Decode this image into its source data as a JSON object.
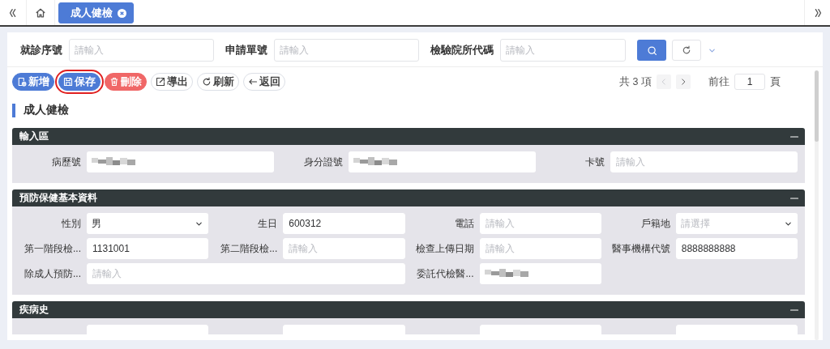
{
  "tabs": [
    {
      "label": "成人健檢",
      "selected": true,
      "closable": true
    }
  ],
  "search_fields": [
    {
      "label": "就診序號",
      "placeholder": "請輸入"
    },
    {
      "label": "申請單號",
      "placeholder": "請輸入"
    },
    {
      "label": "檢驗院所代碼",
      "placeholder": "請輸入"
    }
  ],
  "toolbar": [
    {
      "kind": "add",
      "label": "新增",
      "highlighted": false
    },
    {
      "kind": "save",
      "label": "保存",
      "highlighted": true
    },
    {
      "kind": "delete",
      "label": "刪除",
      "highlighted": false
    },
    {
      "kind": "export",
      "label": "導出",
      "highlighted": false
    },
    {
      "kind": "refresh",
      "label": "刷新",
      "highlighted": false
    },
    {
      "kind": "back",
      "label": "返回",
      "highlighted": false
    }
  ],
  "pager": {
    "total": "共 3 項",
    "prev_disabled": true,
    "next_disabled": false,
    "goto_label": "前往",
    "page": "1",
    "page_suffix": "頁"
  },
  "section_title": "成人健檢",
  "panels": [
    {
      "title": "輸入區",
      "expanded": true,
      "kind": "triple",
      "fields": [
        {
          "label": "病歷號",
          "kind": "redacted"
        },
        {
          "label": "身分證號",
          "kind": "redacted"
        },
        {
          "label": "卡號",
          "kind": "input",
          "placeholder": "請輸入"
        }
      ]
    },
    {
      "title": "預防保健基本資料",
      "expanded": true,
      "kind": "quad",
      "fields": [
        {
          "label": "性別",
          "kind": "select",
          "value": "男"
        },
        {
          "label": "生日",
          "kind": "input",
          "value": "600312"
        },
        {
          "label": "電話",
          "kind": "input",
          "placeholder": "請輸入"
        },
        {
          "label": "戶籍地",
          "kind": "select",
          "placeholder": "請選擇"
        },
        {
          "label": "第一階段檢...",
          "kind": "input",
          "value": "1131001"
        },
        {
          "label": "第二階段檢...",
          "kind": "input",
          "placeholder": "請輸入"
        },
        {
          "label": "檢查上傳日期",
          "kind": "input",
          "placeholder": "請輸入"
        },
        {
          "label": "醫事機構代號",
          "kind": "input",
          "value": "8888888888"
        },
        {
          "label": "除成人預防...",
          "kind": "input",
          "placeholder": "請輸入",
          "wide": true
        },
        {
          "label": "委託代檢醫...",
          "kind": "redacted"
        }
      ]
    },
    {
      "title": "疾病史",
      "expanded": true,
      "kind": "quad",
      "fields": [
        {
          "kind": "input"
        },
        {
          "kind": "input"
        },
        {
          "kind": "input"
        },
        {
          "kind": "input"
        }
      ]
    }
  ]
}
